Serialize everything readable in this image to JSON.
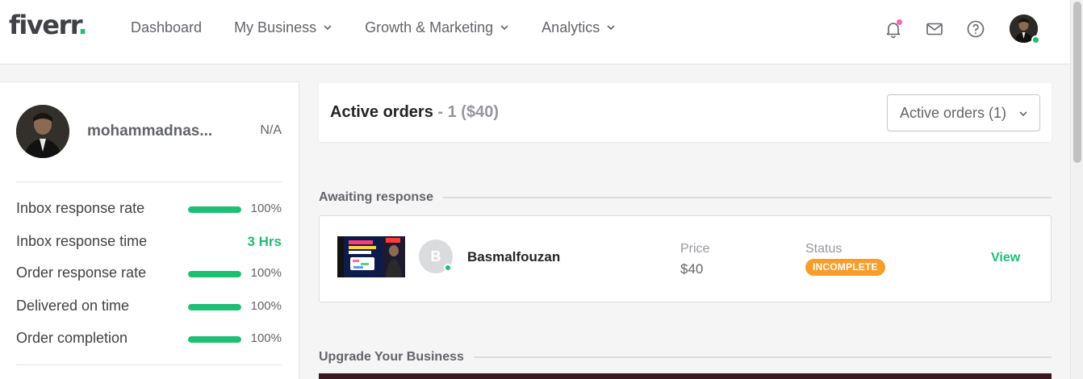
{
  "header": {
    "logo_text": "fiverr",
    "logo_dot": ".",
    "nav": [
      {
        "label": "Dashboard",
        "has_dropdown": false
      },
      {
        "label": "My Business",
        "has_dropdown": true
      },
      {
        "label": "Growth & Marketing",
        "has_dropdown": true
      },
      {
        "label": "Analytics",
        "has_dropdown": true
      }
    ],
    "icons": [
      "bell-icon",
      "envelope-icon",
      "help-icon"
    ],
    "notification_dot_color": "#ff62ad"
  },
  "sidebar": {
    "username": "mohammadnas...",
    "seller_level": "N/A",
    "stats": [
      {
        "label": "Inbox response rate",
        "value": "100%",
        "progress": 1.0
      },
      {
        "label": "Inbox response time",
        "value": "3 Hrs"
      },
      {
        "label": "Order response rate",
        "value": "100%",
        "progress": 1.0
      },
      {
        "label": "Delivered on time",
        "value": "100%",
        "progress": 1.0
      },
      {
        "label": "Order completion",
        "value": "100%",
        "progress": 1.0
      }
    ]
  },
  "active_orders": {
    "title": "Active orders",
    "count_text": "- 1 ($40)",
    "dropdown_value": "Active orders (1)"
  },
  "sections": {
    "awaiting": "Awaiting response",
    "upgrade": "Upgrade Your Business"
  },
  "order": {
    "buyer_initial": "B",
    "buyer_name": "Basmalfouzan",
    "price_label": "Price",
    "price_value": "$40",
    "status_label": "Status",
    "status_value": "INCOMPLETE",
    "action": "View"
  },
  "colors": {
    "brand_green": "#1dbf73",
    "status_orange": "#f99d29"
  }
}
